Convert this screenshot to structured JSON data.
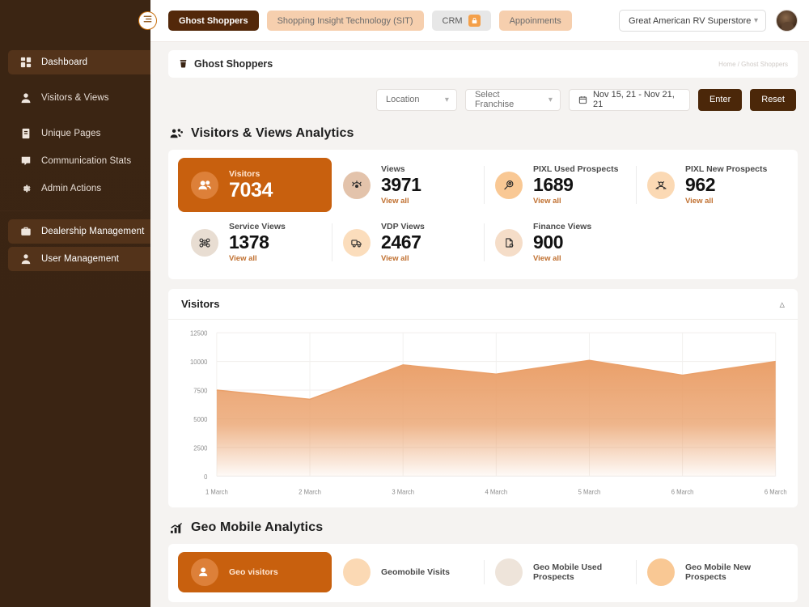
{
  "sidebar": {
    "toggle_icon": "hamburger-menu-icon",
    "items": [
      {
        "label": "Dashboard",
        "icon": "grid-icon",
        "active": true
      },
      {
        "label": "Visitors & Views",
        "icon": "user-icon",
        "active": false
      },
      {
        "label": "Unique Pages",
        "icon": "clipboard-icon",
        "active": false
      },
      {
        "label": "Communication Stats",
        "icon": "chat-icon",
        "active": false
      },
      {
        "label": "Admin Actions",
        "icon": "gear-icon",
        "active": false
      }
    ],
    "items2": [
      {
        "label": "Dealership Management",
        "icon": "briefcase-icon",
        "active": true
      },
      {
        "label": "User Management",
        "icon": "person-icon",
        "active": true
      }
    ]
  },
  "topbar": {
    "tabs": [
      {
        "label": "Ghost Shoppers",
        "style": "dark",
        "locked": false
      },
      {
        "label": "Shopping Insight Technology (SIT)",
        "style": "peach",
        "locked": false
      },
      {
        "label": "CRM",
        "style": "grey",
        "locked": true
      },
      {
        "label": "Appoinments",
        "style": "peach",
        "locked": false
      }
    ],
    "store": "Great American RV Superstore",
    "chevron": "chevron-down-icon",
    "avatar": "user-avatar"
  },
  "page": {
    "title": "Ghost Shoppers",
    "title_icon": "cup-icon",
    "breadcrumb": "Home / Ghost Shoppers"
  },
  "filters": {
    "location": "Location",
    "franchise": "Select Franchise",
    "date_range": "Nov 15, 21  -  Nov 21, 21",
    "calendar_icon": "calendar-icon",
    "enter": "Enter",
    "reset": "Reset"
  },
  "analytics": {
    "section_title": "Visitors & Views Analytics",
    "section_icon": "people-group-icon",
    "view_all": "View all",
    "row1": [
      {
        "label": "Visitors",
        "value": "7034",
        "icon": "visitors-icon",
        "highlight": true,
        "show_view_all": false
      },
      {
        "label": "Views",
        "value": "3971",
        "icon": "eye-icon",
        "highlight": false,
        "show_view_all": true
      },
      {
        "label": "PIXL Used Prospects",
        "value": "1689",
        "icon": "magnifier-icon",
        "highlight": false,
        "show_view_all": true
      },
      {
        "label": "PIXL New Prospects",
        "value": "962",
        "icon": "new-prospect-icon",
        "highlight": false,
        "show_view_all": true
      }
    ],
    "row2": [
      {
        "label": "Service Views",
        "value": "1378",
        "icon": "gears-icon",
        "highlight": false,
        "show_view_all": true
      },
      {
        "label": "VDP Views",
        "value": "2467",
        "icon": "truck-icon",
        "highlight": false,
        "show_view_all": true
      },
      {
        "label": "Finance Views",
        "value": "900",
        "icon": "document-icon",
        "highlight": false,
        "show_view_all": true
      }
    ]
  },
  "visitors_card": {
    "title": "Visitors",
    "collapse_icon": "chevron-up-icon"
  },
  "geo": {
    "section_title": "Geo Mobile Analytics",
    "section_icon": "bar-chart-icon",
    "cards": [
      {
        "label": "Geo visitors",
        "highlight": true
      },
      {
        "label": "Geomobile Visits",
        "highlight": false
      },
      {
        "label": "Geo Mobile Used Prospects",
        "highlight": false
      },
      {
        "label": "Geo Mobile New Prospects",
        "highlight": false
      }
    ]
  },
  "colors": {
    "accent": "#c8600e",
    "sidebar": "#3a2414",
    "sidebar_active": "#53331a",
    "tab_dark": "#53280a",
    "tab_peach": "#f6cfae",
    "chart_fill": "#eaa06a",
    "button": "#4b2709"
  },
  "chart_data": {
    "type": "area",
    "title": "Visitors",
    "xlabel": "",
    "ylabel": "",
    "x": [
      "1 March",
      "2 March",
      "3 March",
      "4 March",
      "5 March",
      "6 March",
      "6 March"
    ],
    "categories": [
      "1 March",
      "2 March",
      "3 March",
      "4 March",
      "5 March",
      "6 March",
      "6 March"
    ],
    "series": [
      {
        "name": "Visitors",
        "values": [
          7500,
          6700,
          9700,
          8900,
          10100,
          8800,
          10000
        ]
      }
    ],
    "values": [
      7500,
      6700,
      9700,
      8900,
      10100,
      8800,
      10000
    ],
    "yticks": [
      0,
      2500,
      5000,
      7500,
      10000,
      12500
    ],
    "ytick_labels": [
      "0",
      "2500",
      "5000",
      "7500",
      "10000",
      "12500"
    ],
    "ylim": [
      0,
      12500
    ],
    "grid": true,
    "legend": "none",
    "fill_color": "#eaa06a"
  }
}
